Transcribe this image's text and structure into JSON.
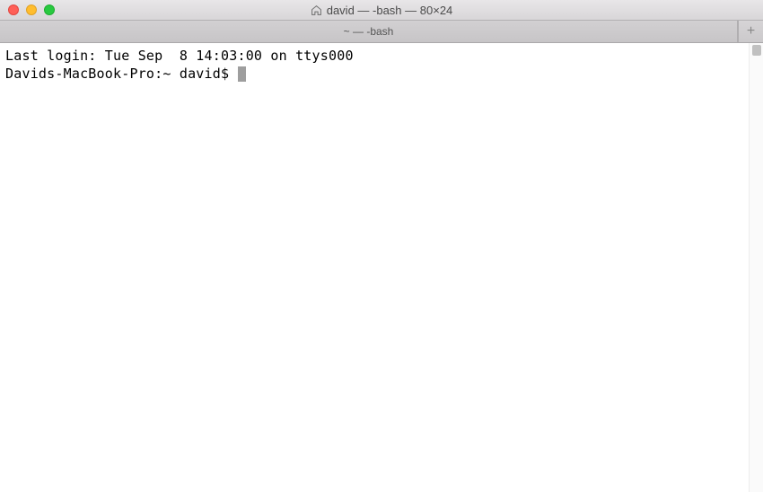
{
  "window": {
    "title": "david — -bash — 80×24"
  },
  "tabs": {
    "active_label": "~ — -bash",
    "new_tab_glyph": "+"
  },
  "terminal": {
    "last_login_line": "Last login: Tue Sep  8 14:03:00 on ttys000",
    "prompt": "Davids-MacBook-Pro:~ david$ "
  }
}
